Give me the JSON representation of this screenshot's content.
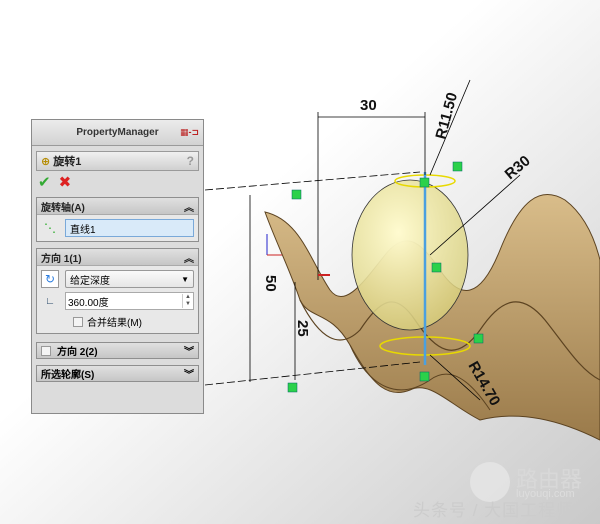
{
  "property_manager": {
    "title": "PropertyManager",
    "feature_name": "旋转1",
    "help": "?",
    "ok": "✔",
    "cancel": "✖",
    "axis_group": {
      "label": "旋转轴(A)",
      "value": "直线1"
    },
    "direction1": {
      "label": "方向 1(1)",
      "end_condition": "给定深度",
      "angle": "360.00度",
      "merge_label": "合并结果(M)",
      "merge_checked": false
    },
    "direction2": {
      "label": "方向 2(2)",
      "checked": false
    },
    "contours": {
      "label": "所选轮廓(S)"
    }
  },
  "dimensions": {
    "d30": "30",
    "r1150": "R11.50",
    "r30": "R30",
    "d50": "50",
    "d25": "25",
    "r1470": "R14.70"
  },
  "watermark": {
    "logo": "路由器",
    "site": "luyouqi.com",
    "author": "头条号 / 大国工程师"
  }
}
